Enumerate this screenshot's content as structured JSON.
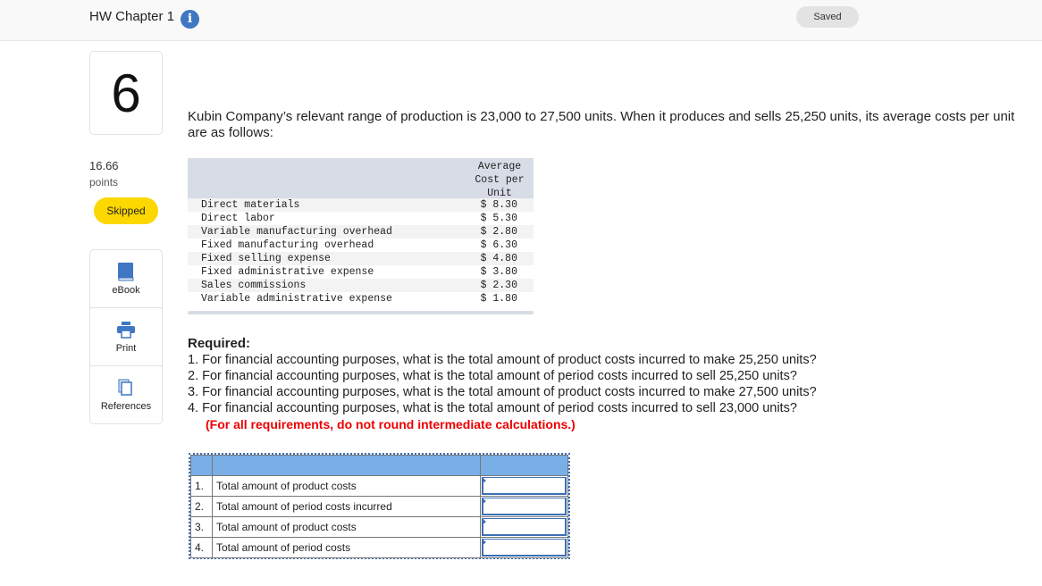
{
  "header": {
    "title": "HW Chapter 1",
    "info_icon": "info-icon",
    "status": "Saved"
  },
  "question": {
    "number": "6",
    "points": "16.66",
    "points_label": "points",
    "status": "Skipped"
  },
  "tools": [
    {
      "label": "eBook",
      "icon": "book-icon"
    },
    {
      "label": "Print",
      "icon": "printer-icon"
    },
    {
      "label": "References",
      "icon": "copy-icon"
    }
  ],
  "intro": "Kubin Company’s relevant range of production is 23,000 to 27,500 units. When it produces and sells 25,250 units, its average costs per unit are as follows:",
  "cost_table": {
    "header": "Average Cost per Unit",
    "rows": [
      {
        "label": "Direct materials",
        "value": "$ 8.30"
      },
      {
        "label": "Direct labor",
        "value": "$ 5.30"
      },
      {
        "label": "Variable manufacturing overhead",
        "value": "$ 2.80"
      },
      {
        "label": "Fixed manufacturing overhead",
        "value": "$ 6.30"
      },
      {
        "label": "Fixed selling expense",
        "value": "$ 4.80"
      },
      {
        "label": "Fixed administrative expense",
        "value": "$ 3.80"
      },
      {
        "label": "Sales commissions",
        "value": "$ 2.30"
      },
      {
        "label": "Variable administrative expense",
        "value": "$ 1.80"
      }
    ]
  },
  "required": {
    "title": "Required:",
    "items": [
      "1. For financial accounting purposes, what is the total amount of product costs incurred to make 25,250 units?",
      "2. For financial accounting purposes, what is the total amount of period costs incurred to sell 25,250 units?",
      "3. For financial accounting purposes, what is the total amount of product costs incurred to make 27,500 units?",
      "4. For financial accounting purposes, what is the total amount of period costs incurred to sell 23,000 units?"
    ],
    "note": "(For all requirements, do not round intermediate calculations.)"
  },
  "answer_table": {
    "rows": [
      {
        "num": "1.",
        "label": "Total amount of product costs",
        "value": ""
      },
      {
        "num": "2.",
        "label": "Total amount of period costs incurred",
        "value": ""
      },
      {
        "num": "3.",
        "label": "Total amount of product costs",
        "value": ""
      },
      {
        "num": "4.",
        "label": "Total amount of period costs",
        "value": ""
      }
    ]
  }
}
